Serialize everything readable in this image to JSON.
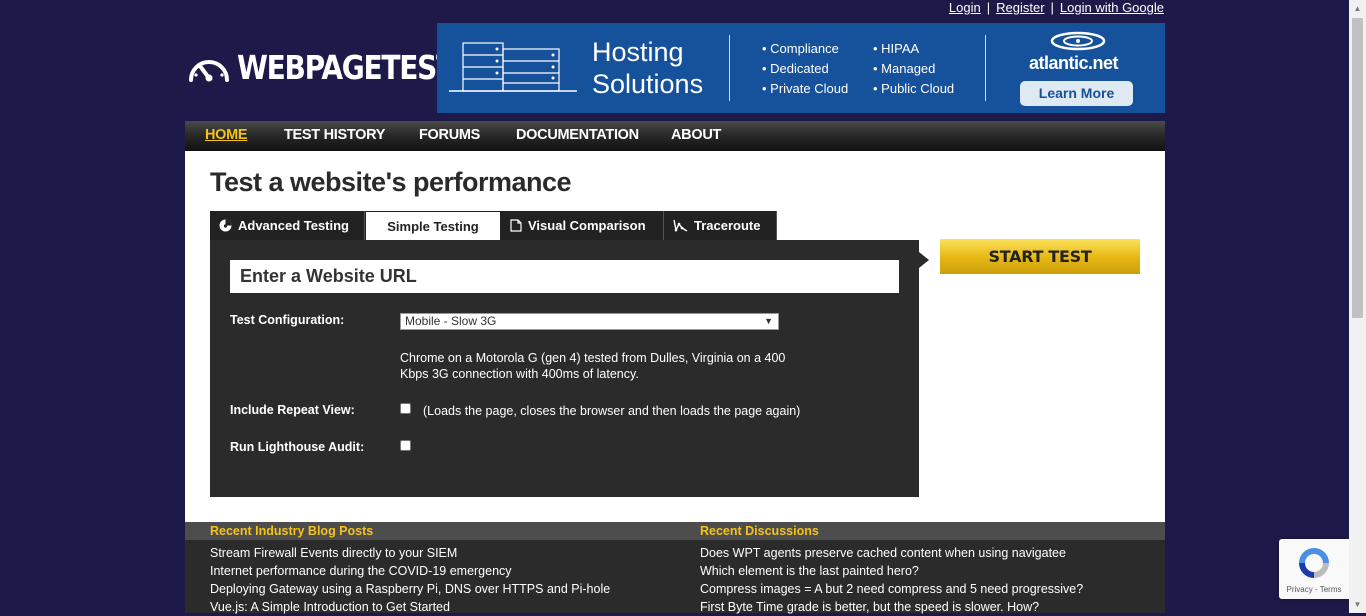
{
  "top_links": {
    "login": "Login",
    "register": "Register",
    "login_google": "Login with Google",
    "separator": "|"
  },
  "logo": {
    "text": "WEBPAGETEST"
  },
  "ad": {
    "title_line1": "Hosting",
    "title_line2": "Solutions",
    "col1": [
      "Compliance",
      "Dedicated",
      "Private Cloud"
    ],
    "col2": [
      "HIPAA",
      "Managed",
      "Public Cloud"
    ],
    "brand": "atlantic.net",
    "cta": "Learn More",
    "bg_color": "#16519c"
  },
  "nav": {
    "items": [
      {
        "label": "HOME",
        "active": true
      },
      {
        "label": "TEST HISTORY"
      },
      {
        "label": "FORUMS"
      },
      {
        "label": "DOCUMENTATION"
      },
      {
        "label": "ABOUT"
      }
    ],
    "accent_color": "#f4c21b"
  },
  "main": {
    "title": "Test a website's performance",
    "tabs": [
      {
        "label": "Advanced Testing",
        "icon": "gauge-icon"
      },
      {
        "label": "Simple Testing",
        "active": true
      },
      {
        "label": "Visual Comparison",
        "icon": "document-icon"
      },
      {
        "label": "Traceroute",
        "icon": "traceroute-icon"
      }
    ],
    "url_placeholder": "Enter a Website URL",
    "config_label": "Test Configuration:",
    "config_value": "Mobile - Slow 3G",
    "config_description": "Chrome on a Motorola G (gen 4) tested from Dulles, Virginia on a 400 Kbps 3G connection with 400ms of latency.",
    "repeat_label": "Include Repeat View:",
    "repeat_note": "(Loads the page, closes the browser and then loads the page again)",
    "lighthouse_label": "Run Lighthouse Audit:",
    "start_button": "START TEST"
  },
  "blog": {
    "heading": "Recent Industry Blog Posts",
    "items": [
      "Stream Firewall Events directly to your SIEM",
      "Internet performance during the COVID-19 emergency",
      "Deploying Gateway using a Raspberry Pi, DNS over HTTPS and Pi-hole",
      "Vue.js: A Simple Introduction to Get Started"
    ]
  },
  "discussions": {
    "heading": "Recent Discussions",
    "items": [
      "Does WPT agents preserve cached content when using navigatee",
      "Which element is the last painted hero?",
      "Compress images = A but 2 need compress and 5 need progressive?",
      "First Byte Time grade is better, but the speed is slower. How?"
    ]
  },
  "recaptcha": {
    "text": "Privacy - Terms"
  }
}
